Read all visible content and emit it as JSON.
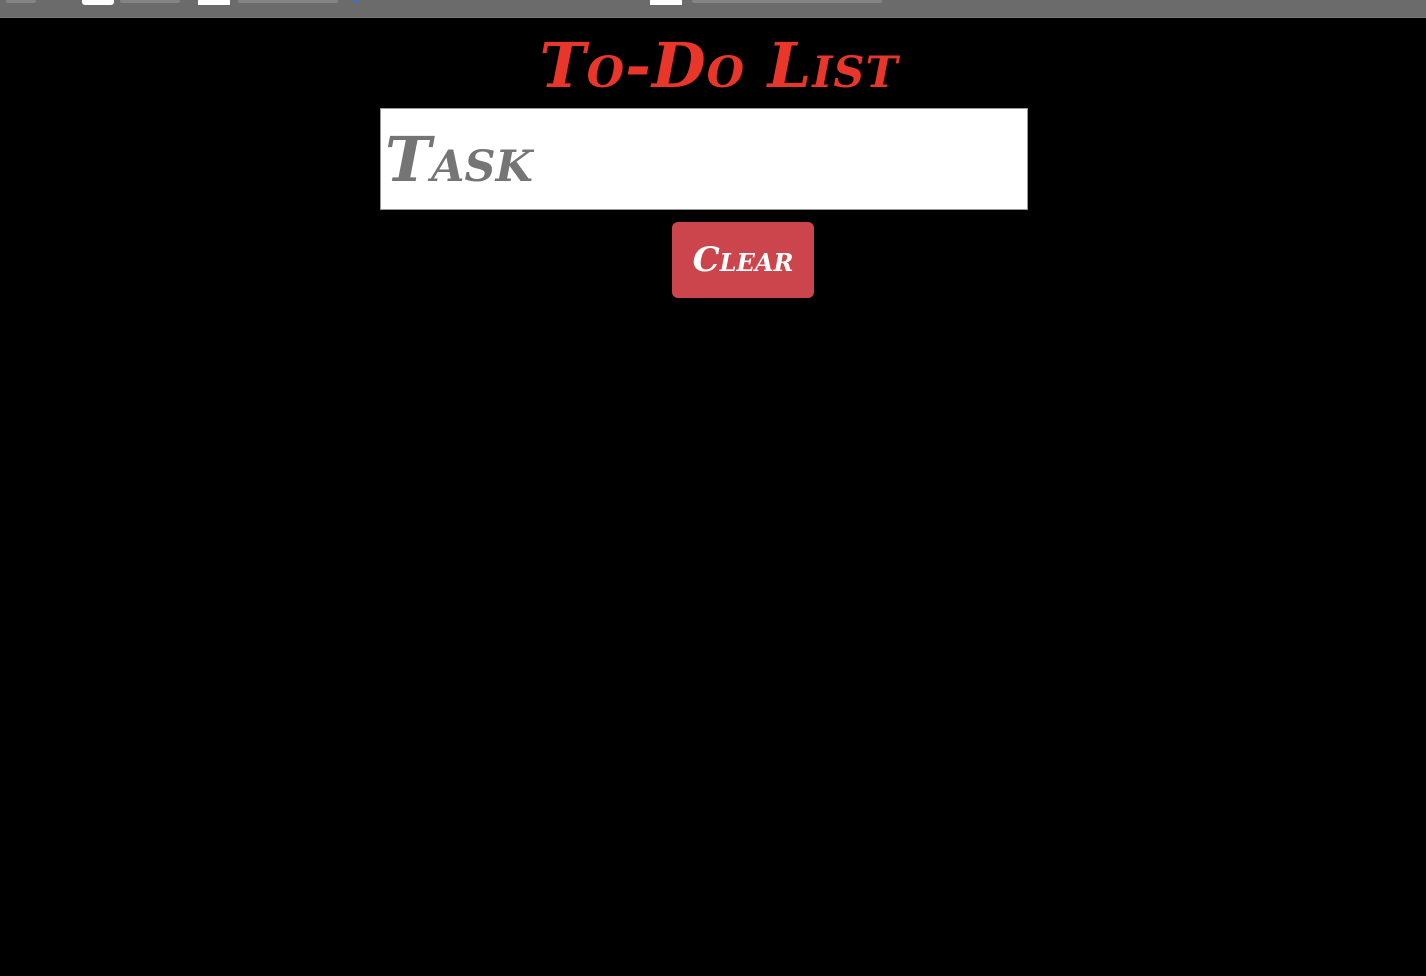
{
  "app": {
    "title": "To-Do List"
  },
  "task_input": {
    "value": "",
    "placeholder": "Task"
  },
  "actions": {
    "clear_label": "Clear"
  },
  "colors": {
    "background": "#000000",
    "title": "#e8362a",
    "clear_button": "#cc444c",
    "bookmarks_bar": "#6b6b6b"
  }
}
